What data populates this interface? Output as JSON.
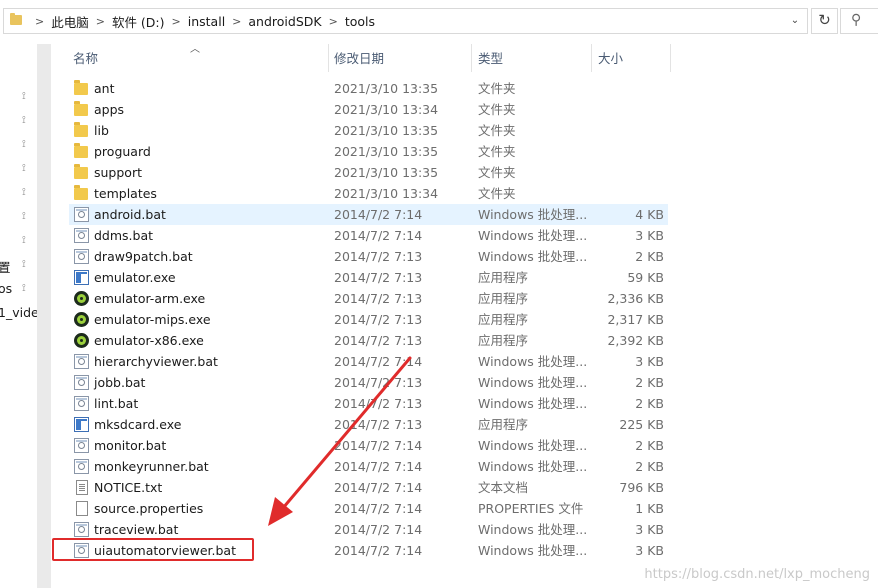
{
  "address_bar": {
    "breadcrumbs": [
      "此电脑",
      "软件 (D:)",
      "install",
      "androidSDK",
      "tools"
    ],
    "separator": ">",
    "dropdown_glyph": "⌄",
    "refresh_glyph": "↻"
  },
  "nav_pane": {
    "labels": [
      "置",
      "os",
      "1_vide"
    ]
  },
  "columns": {
    "name": "名称",
    "date": "修改日期",
    "type": "类型",
    "size": "大小"
  },
  "files": [
    {
      "icon": "folder-icon",
      "name": "ant",
      "date": "2021/3/10 13:35",
      "type": "文件夹",
      "size": ""
    },
    {
      "icon": "folder-icon",
      "name": "apps",
      "date": "2021/3/10 13:34",
      "type": "文件夹",
      "size": ""
    },
    {
      "icon": "folder-icon",
      "name": "lib",
      "date": "2021/3/10 13:35",
      "type": "文件夹",
      "size": ""
    },
    {
      "icon": "folder-icon",
      "name": "proguard",
      "date": "2021/3/10 13:35",
      "type": "文件夹",
      "size": ""
    },
    {
      "icon": "folder-icon",
      "name": "support",
      "date": "2021/3/10 13:35",
      "type": "文件夹",
      "size": ""
    },
    {
      "icon": "folder-icon",
      "name": "templates",
      "date": "2021/3/10 13:34",
      "type": "文件夹",
      "size": ""
    },
    {
      "icon": "batch-file-icon",
      "name": "android.bat",
      "date": "2014/7/2 7:14",
      "type": "Windows 批处理...",
      "size": "4 KB"
    },
    {
      "icon": "batch-file-icon",
      "name": "ddms.bat",
      "date": "2014/7/2 7:14",
      "type": "Windows 批处理...",
      "size": "3 KB"
    },
    {
      "icon": "batch-file-icon",
      "name": "draw9patch.bat",
      "date": "2014/7/2 7:13",
      "type": "Windows 批处理...",
      "size": "2 KB"
    },
    {
      "icon": "application-icon",
      "name": "emulator.exe",
      "date": "2014/7/2 7:13",
      "type": "应用程序",
      "size": "59 KB"
    },
    {
      "icon": "emulator-icon",
      "name": "emulator-arm.exe",
      "date": "2014/7/2 7:13",
      "type": "应用程序",
      "size": "2,336 KB"
    },
    {
      "icon": "emulator-icon",
      "name": "emulator-mips.exe",
      "date": "2014/7/2 7:13",
      "type": "应用程序",
      "size": "2,317 KB"
    },
    {
      "icon": "emulator-icon",
      "name": "emulator-x86.exe",
      "date": "2014/7/2 7:13",
      "type": "应用程序",
      "size": "2,392 KB"
    },
    {
      "icon": "batch-file-icon",
      "name": "hierarchyviewer.bat",
      "date": "2014/7/2 7:14",
      "type": "Windows 批处理...",
      "size": "3 KB"
    },
    {
      "icon": "batch-file-icon",
      "name": "jobb.bat",
      "date": "2014/7/2 7:13",
      "type": "Windows 批处理...",
      "size": "2 KB"
    },
    {
      "icon": "batch-file-icon",
      "name": "lint.bat",
      "date": "2014/7/2 7:13",
      "type": "Windows 批处理...",
      "size": "2 KB"
    },
    {
      "icon": "application-icon",
      "name": "mksdcard.exe",
      "date": "2014/7/2 7:13",
      "type": "应用程序",
      "size": "225 KB"
    },
    {
      "icon": "batch-file-icon",
      "name": "monitor.bat",
      "date": "2014/7/2 7:14",
      "type": "Windows 批处理...",
      "size": "2 KB"
    },
    {
      "icon": "batch-file-icon",
      "name": "monkeyrunner.bat",
      "date": "2014/7/2 7:14",
      "type": "Windows 批处理...",
      "size": "2 KB"
    },
    {
      "icon": "text-document-icon",
      "name": "NOTICE.txt",
      "date": "2014/7/2 7:14",
      "type": "文本文档",
      "size": "796 KB"
    },
    {
      "icon": "generic-file-icon",
      "name": "source.properties",
      "date": "2014/7/2 7:14",
      "type": "PROPERTIES 文件",
      "size": "1 KB"
    },
    {
      "icon": "batch-file-icon",
      "name": "traceview.bat",
      "date": "2014/7/2 7:14",
      "type": "Windows 批处理...",
      "size": "3 KB"
    },
    {
      "icon": "batch-file-icon",
      "name": "uiautomatorviewer.bat",
      "date": "2014/7/2 7:14",
      "type": "Windows 批处理...",
      "size": "3 KB"
    }
  ],
  "hovered_file": "android.bat",
  "highlighted_file": "uiautomatorviewer.bat",
  "annotation_color": "#e02b2b",
  "hover_color": "#e5f3ff",
  "watermark": "https://blog.csdn.net/lxp_mocheng"
}
